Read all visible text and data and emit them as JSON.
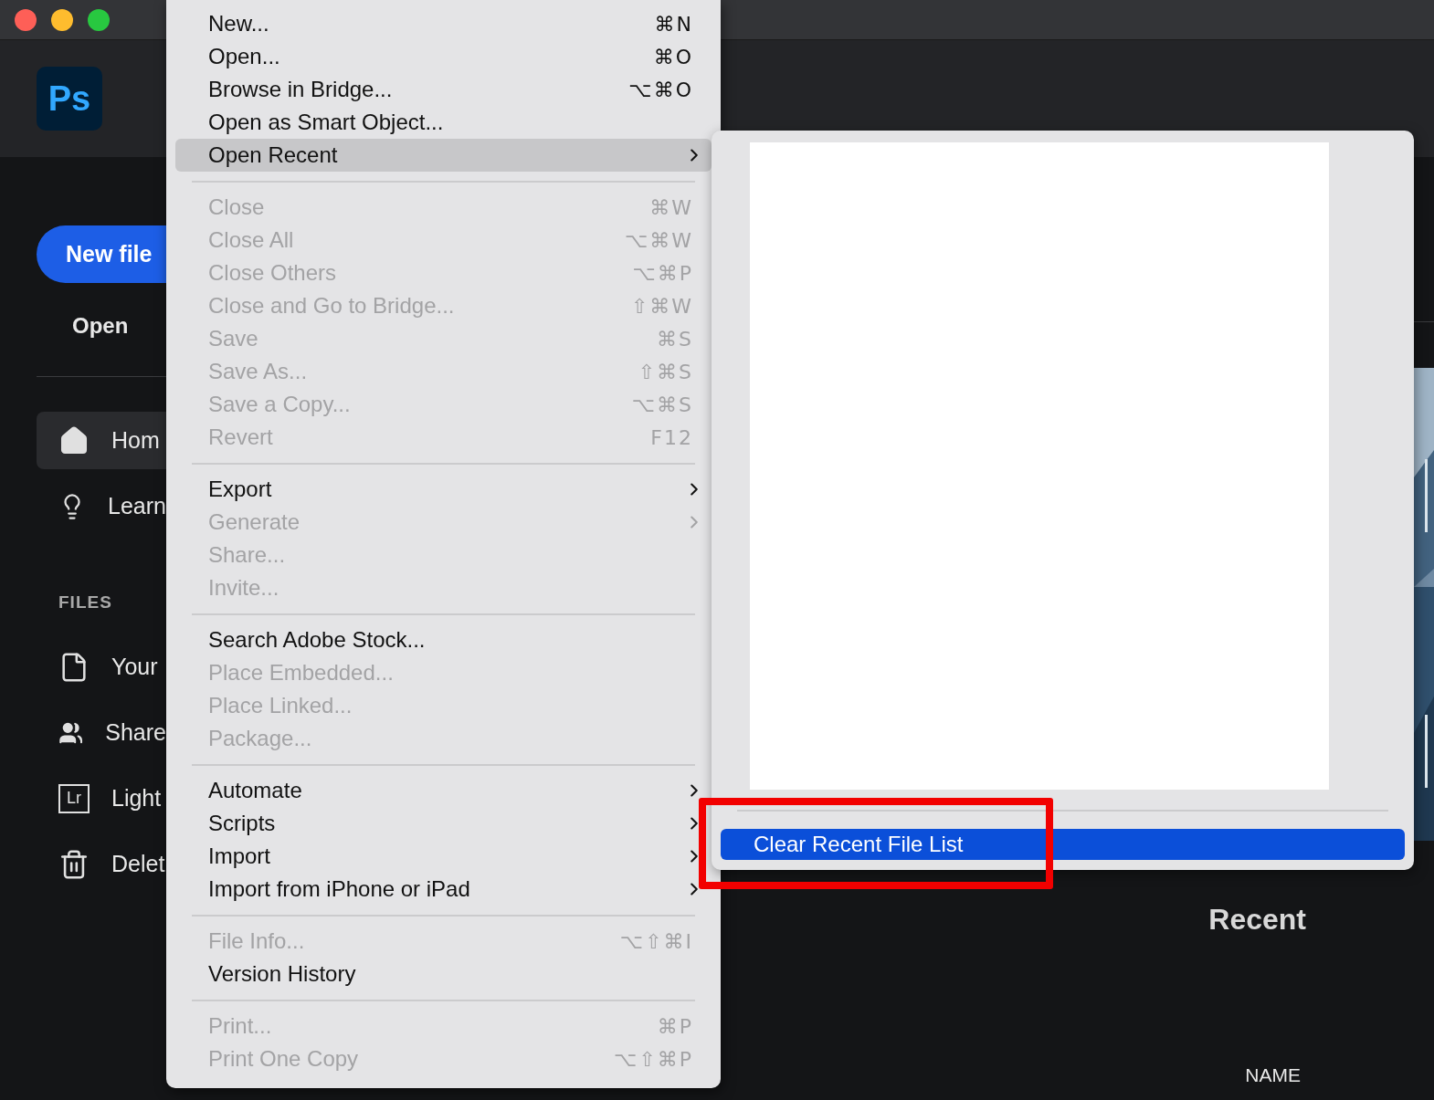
{
  "app": {
    "logo": "Ps",
    "new_file_button": "New file",
    "open_button": "Open",
    "nav": [
      {
        "label": "Hom",
        "kind": "home",
        "selected": true
      },
      {
        "label": "Learn",
        "kind": "bulb",
        "selected": false
      }
    ],
    "files_heading": "FILES",
    "files": [
      {
        "label": "Your",
        "kind": "file",
        "selected": false
      },
      {
        "label": "Share",
        "kind": "users",
        "selected": false
      },
      {
        "label": "Light",
        "kind": "lr",
        "icon_text": "Lr",
        "selected": false
      },
      {
        "label": "Delet",
        "kind": "trash",
        "selected": false
      }
    ],
    "recent_heading": "Recent",
    "column_header": "NAME"
  },
  "menu": {
    "items": [
      {
        "kind": "item",
        "label": "New...",
        "shortcut": "⌘N",
        "disabled": false,
        "submenu": false,
        "selected": false
      },
      {
        "kind": "item",
        "label": "Open...",
        "shortcut": "⌘O",
        "disabled": false,
        "submenu": false,
        "selected": false
      },
      {
        "kind": "item",
        "label": "Browse in Bridge...",
        "shortcut": "⌥⌘O",
        "disabled": false,
        "submenu": false,
        "selected": false
      },
      {
        "kind": "item",
        "label": "Open as Smart Object...",
        "disabled": false,
        "submenu": false,
        "selected": false
      },
      {
        "kind": "item",
        "label": "Open Recent",
        "disabled": false,
        "submenu": true,
        "selected": true
      },
      {
        "kind": "separator"
      },
      {
        "kind": "item",
        "label": "Close",
        "shortcut": "⌘W",
        "disabled": true,
        "submenu": false,
        "selected": false
      },
      {
        "kind": "item",
        "label": "Close All",
        "shortcut": "⌥⌘W",
        "disabled": true,
        "submenu": false,
        "selected": false
      },
      {
        "kind": "item",
        "label": "Close Others",
        "shortcut": "⌥⌘P",
        "disabled": true,
        "submenu": false,
        "selected": false
      },
      {
        "kind": "item",
        "label": "Close and Go to Bridge...",
        "shortcut": "⇧⌘W",
        "disabled": true,
        "submenu": false,
        "selected": false
      },
      {
        "kind": "item",
        "label": "Save",
        "shortcut": "⌘S",
        "disabled": true,
        "submenu": false,
        "selected": false
      },
      {
        "kind": "item",
        "label": "Save As...",
        "shortcut": "⇧⌘S",
        "disabled": true,
        "submenu": false,
        "selected": false
      },
      {
        "kind": "item",
        "label": "Save a Copy...",
        "shortcut": "⌥⌘S",
        "disabled": true,
        "submenu": false,
        "selected": false
      },
      {
        "kind": "item",
        "label": "Revert",
        "shortcut": "F12",
        "disabled": true,
        "submenu": false,
        "selected": false
      },
      {
        "kind": "separator"
      },
      {
        "kind": "item",
        "label": "Export",
        "disabled": false,
        "submenu": true,
        "selected": false
      },
      {
        "kind": "item",
        "label": "Generate",
        "disabled": true,
        "submenu": true,
        "selected": false
      },
      {
        "kind": "item",
        "label": "Share...",
        "disabled": true,
        "submenu": false,
        "selected": false
      },
      {
        "kind": "item",
        "label": "Invite...",
        "disabled": true,
        "submenu": false,
        "selected": false
      },
      {
        "kind": "separator"
      },
      {
        "kind": "item",
        "label": "Search Adobe Stock...",
        "disabled": false,
        "submenu": false,
        "selected": false
      },
      {
        "kind": "item",
        "label": "Place Embedded...",
        "disabled": true,
        "submenu": false,
        "selected": false
      },
      {
        "kind": "item",
        "label": "Place Linked...",
        "disabled": true,
        "submenu": false,
        "selected": false
      },
      {
        "kind": "item",
        "label": "Package...",
        "disabled": true,
        "submenu": false,
        "selected": false
      },
      {
        "kind": "separator"
      },
      {
        "kind": "item",
        "label": "Automate",
        "disabled": false,
        "submenu": true,
        "selected": false
      },
      {
        "kind": "item",
        "label": "Scripts",
        "disabled": false,
        "submenu": true,
        "selected": false
      },
      {
        "kind": "item",
        "label": "Import",
        "disabled": false,
        "submenu": true,
        "selected": false
      },
      {
        "kind": "item",
        "label": "Import from iPhone or iPad",
        "disabled": false,
        "submenu": true,
        "selected": false
      },
      {
        "kind": "separator"
      },
      {
        "kind": "item",
        "label": "File Info...",
        "shortcut": "⌥⇧⌘I",
        "disabled": true,
        "submenu": false,
        "selected": false
      },
      {
        "kind": "item",
        "label": "Version History",
        "disabled": false,
        "submenu": false,
        "selected": false
      },
      {
        "kind": "separator"
      },
      {
        "kind": "item",
        "label": "Print...",
        "shortcut": "⌘P",
        "disabled": true,
        "submenu": false,
        "selected": false
      },
      {
        "kind": "item",
        "label": "Print One Copy",
        "shortcut": "⌥⇧⌘P",
        "disabled": true,
        "submenu": false,
        "selected": false
      }
    ]
  },
  "submenu": {
    "items": [
      {
        "label": "Clear Recent File List",
        "selected": true
      }
    ]
  }
}
